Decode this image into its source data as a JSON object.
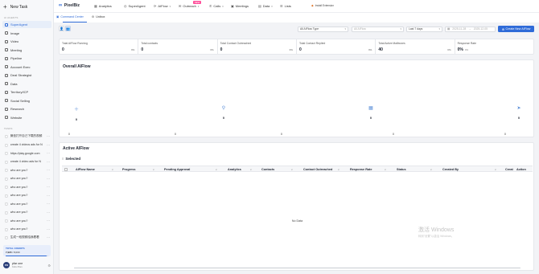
{
  "sidebar": {
    "new_task": "New Task",
    "section_agents": "AI AGENTS",
    "nav": [
      {
        "label": "SuperAgent",
        "icon": "superagent-icon"
      },
      {
        "label": "Image",
        "icon": "image-icon"
      },
      {
        "label": "Video",
        "icon": "video-icon"
      },
      {
        "label": "Meeting",
        "icon": "meeting-icon"
      },
      {
        "label": "Pipeline",
        "icon": "pipeline-icon"
      },
      {
        "label": "Account Exec",
        "icon": "account-exec-icon"
      },
      {
        "label": "Deal Strategist",
        "icon": "deal-strategist-icon"
      },
      {
        "label": "Data",
        "icon": "data-icon"
      },
      {
        "label": "Territory/ICP",
        "icon": "territory-icon"
      },
      {
        "label": "Social Selling",
        "icon": "social-selling-icon"
      },
      {
        "label": "Research",
        "icon": "research-icon"
      },
      {
        "label": "Website",
        "icon": "website-icon"
      }
    ],
    "section_tasks": "TASKS",
    "tasks": [
      "微信打开自己下载的视频",
      "create 4 videos ads for N",
      "https://play.google.com",
      "create 4 video ads for N",
      "who are you?",
      "who are you?",
      "who are you?",
      "who are you?",
      "who are you?",
      "who are you?",
      "who are you?",
      "who are you?",
      "生成一段视频给我看看"
    ],
    "credits": {
      "title": "TOTAL CREDITS",
      "value": "7,995",
      "sub": "/ 8,000",
      "used_fraction": 0.96
    },
    "user": {
      "initials": "PO",
      "name": "pfar one",
      "plan": "Kids Plan"
    }
  },
  "topbar": {
    "brand": "PixelBiz",
    "nav": [
      {
        "label": "Analytics",
        "icon": "analytics-icon",
        "dropdown": false
      },
      {
        "label": "SuperAgent",
        "icon": "superagent-icon",
        "dropdown": false
      },
      {
        "label": "AIFlow",
        "icon": "aiflow-icon",
        "dropdown": true
      },
      {
        "label": "Outreach",
        "icon": "outreach-icon",
        "dropdown": true
      },
      {
        "label": "Calls",
        "icon": "phone-icon",
        "dropdown": true
      },
      {
        "label": "Meetings",
        "icon": "calendar-icon",
        "dropdown": false
      },
      {
        "label": "Data",
        "icon": "data-icon",
        "dropdown": true
      },
      {
        "label": "Lists",
        "icon": "lists-icon",
        "dropdown": false
      }
    ],
    "new_badge": "NEW",
    "install": "Install Extension"
  },
  "subtabs": [
    {
      "label": "Command Center",
      "active": true
    },
    {
      "label": "Unibox",
      "active": false
    }
  ],
  "filters": {
    "type": "All AIFlow Type",
    "aiflow_placeholder": "All AIFlow",
    "period": "Last 7 days",
    "date_start": "2025-11-28",
    "date_end": "2025-12-05",
    "create_label": "Create New AIFlow"
  },
  "stats": [
    {
      "label": "Total AIFlow Running",
      "value": "0",
      "pct": "0%"
    },
    {
      "label": "Total contacts",
      "value": "0",
      "pct": "0%"
    },
    {
      "label": "Total Contact Outreached",
      "value": "0",
      "pct": "0%"
    },
    {
      "label": "Total Contact Replied",
      "value": "0",
      "pct": "0%"
    },
    {
      "label": "Total Active Mailboxes",
      "value": "40",
      "pct": "0%"
    },
    {
      "label": "Response Rate",
      "value": "0%",
      "pct": "0%"
    }
  ],
  "overall": {
    "title": "Overall AIFlow",
    "items": [
      {
        "icon": "plus-icon",
        "value": "0"
      },
      {
        "icon": "user-icon",
        "value": "0"
      },
      {
        "icon": "calendar-icon",
        "value": "0"
      },
      {
        "icon": "send-icon",
        "value": "0"
      }
    ],
    "mini": [
      "0",
      "0",
      "0",
      "0",
      "0"
    ]
  },
  "active": {
    "title": "Active AIFlow",
    "selected": "Selected",
    "columns": [
      "AIFlow Name",
      "Progress",
      "Pending Approval",
      "Analytics",
      "Contacts",
      "Contact Outreached",
      "Response Rate",
      "Status",
      "Created By",
      "Creat",
      "Action"
    ],
    "empty": "No Data"
  },
  "watermark": {
    "line1": "激活 Windows",
    "line2": "转到\"设置\"以激活 Windows。"
  }
}
